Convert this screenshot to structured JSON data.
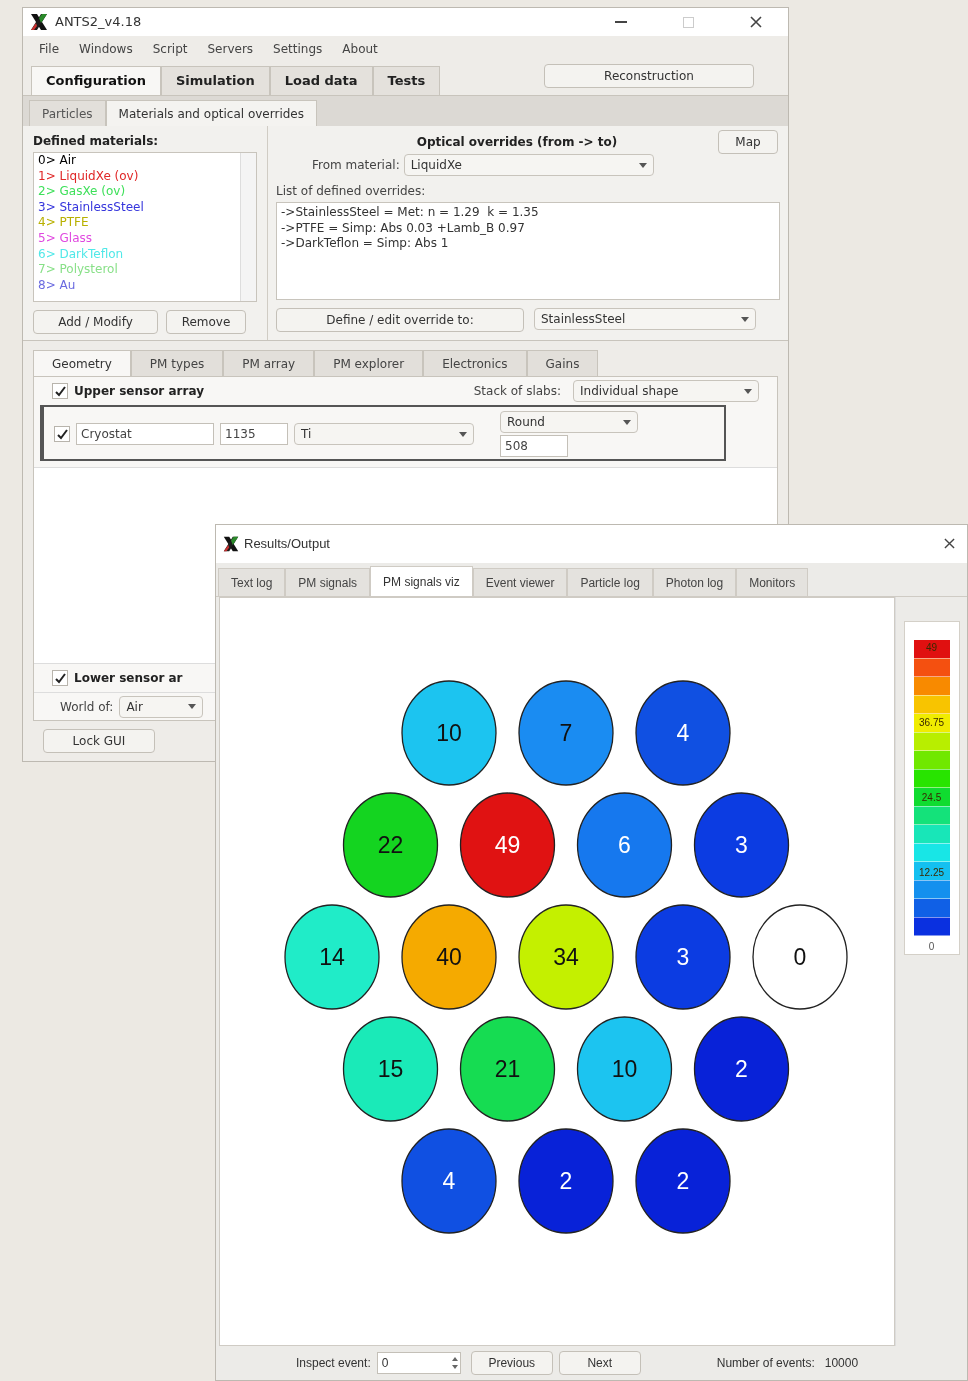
{
  "main_window": {
    "title": "ANTS2_v4.18",
    "menu": [
      "File",
      "Windows",
      "Script",
      "Servers",
      "Settings",
      "About"
    ],
    "tabs": [
      {
        "label": "Configuration",
        "selected": true
      },
      {
        "label": "Simulation",
        "selected": false
      },
      {
        "label": "Load data",
        "selected": false
      },
      {
        "label": "Tests",
        "selected": false
      }
    ],
    "reconstruction_button": "Reconstruction",
    "subtabs": [
      {
        "label": "Particles",
        "selected": false
      },
      {
        "label": "Materials and optical overrides",
        "selected": true
      }
    ],
    "materials": {
      "heading": "Defined materials:",
      "items": [
        {
          "label": "0> Air",
          "color": "#000000"
        },
        {
          "label": "1> LiquidXe (ov)",
          "color": "#e02828"
        },
        {
          "label": "2> GasXe (ov)",
          "color": "#3ee05a"
        },
        {
          "label": "3> StainlessSteel",
          "color": "#3434dc"
        },
        {
          "label": "4> PTFE",
          "color": "#b8b000"
        },
        {
          "label": "5> Glass",
          "color": "#e048e0"
        },
        {
          "label": "6> DarkTeflon",
          "color": "#50e8e8"
        },
        {
          "label": "7> Polysterol",
          "color": "#88e088"
        },
        {
          "label": "8> Au",
          "color": "#6a6ae0"
        }
      ],
      "buttons": [
        "Add / Modify",
        "Remove"
      ]
    },
    "overrides": {
      "heading": "Optical overrides (from -> to)",
      "map_button": "Map",
      "from_label": "From material:",
      "from_value": "LiquidXe",
      "list_label": "List of defined overrides:",
      "lines": [
        "->StainlessSteel = Met: n = 1.29  k = 1.35",
        "->PTFE = Simp: Abs 0.03 +Lamb_B 0.97",
        "->DarkTeflon = Simp: Abs 1"
      ],
      "define_button": "Define / edit override to:",
      "to_value": "StainlessSteel"
    },
    "detector_tabs": [
      {
        "label": "Geometry",
        "selected": true
      },
      {
        "label": "PM types",
        "selected": false
      },
      {
        "label": "PM array",
        "selected": false
      },
      {
        "label": "PM explorer",
        "selected": false
      },
      {
        "label": "Electronics",
        "selected": false
      },
      {
        "label": "Gains",
        "selected": false
      }
    ],
    "upper": {
      "label": "Upper sensor array",
      "checked": true,
      "stack_label": "Stack of slabs:",
      "stack_value": "Individual shape"
    },
    "slab": {
      "checked": true,
      "name": "Cryostat",
      "thickness": "1135",
      "material": "Ti",
      "shape": "Round",
      "size": "508"
    },
    "lower": {
      "label": "Lower sensor ar",
      "checked": true
    },
    "world_label": "World of:",
    "world_value": "Air",
    "lock_button": "Lock GUI"
  },
  "results_window": {
    "title": "Results/Output",
    "tabs": [
      {
        "label": "Text log",
        "selected": false
      },
      {
        "label": "PM signals",
        "selected": false
      },
      {
        "label": "PM signals viz",
        "selected": true
      },
      {
        "label": "Event viewer",
        "selected": false
      },
      {
        "label": "Particle log",
        "selected": false
      },
      {
        "label": "Photon log",
        "selected": false
      },
      {
        "label": "Monitors",
        "selected": false
      }
    ],
    "pm_rows": [
      [
        {
          "value": "10",
          "color": "#1cc4f0"
        },
        {
          "value": "7",
          "color": "#1a8cf2"
        },
        {
          "value": "4",
          "color": "#1050e2"
        }
      ],
      [
        {
          "value": "22",
          "color": "#14d420"
        },
        {
          "value": "49",
          "color": "#e01212"
        },
        {
          "value": "6",
          "color": "#1678ee"
        },
        {
          "value": "3",
          "color": "#0c3ce2"
        }
      ],
      [
        {
          "value": "14",
          "color": "#20ecc8"
        },
        {
          "value": "40",
          "color": "#f5aa00"
        },
        {
          "value": "34",
          "color": "#c4f000"
        },
        {
          "value": "3",
          "color": "#0c3ce2"
        },
        {
          "value": "0",
          "color": "#ffffff"
        }
      ],
      [
        {
          "value": "15",
          "color": "#1aeab8"
        },
        {
          "value": "21",
          "color": "#16dc52"
        },
        {
          "value": "10",
          "color": "#1cc4f0"
        },
        {
          "value": "2",
          "color": "#0822d8"
        }
      ],
      [
        {
          "value": "4",
          "color": "#1050e2"
        },
        {
          "value": "2",
          "color": "#0822d8"
        },
        {
          "value": "2",
          "color": "#0822d8"
        }
      ]
    ],
    "scale_labels": [
      "49",
      "36.75",
      "24.5",
      "12.25",
      "0"
    ],
    "inspect_label": "Inspect event:",
    "inspect_value": "0",
    "previous_button": "Previous",
    "next_button": "Next",
    "events_label": "Number of events:",
    "events_value": "10000"
  }
}
